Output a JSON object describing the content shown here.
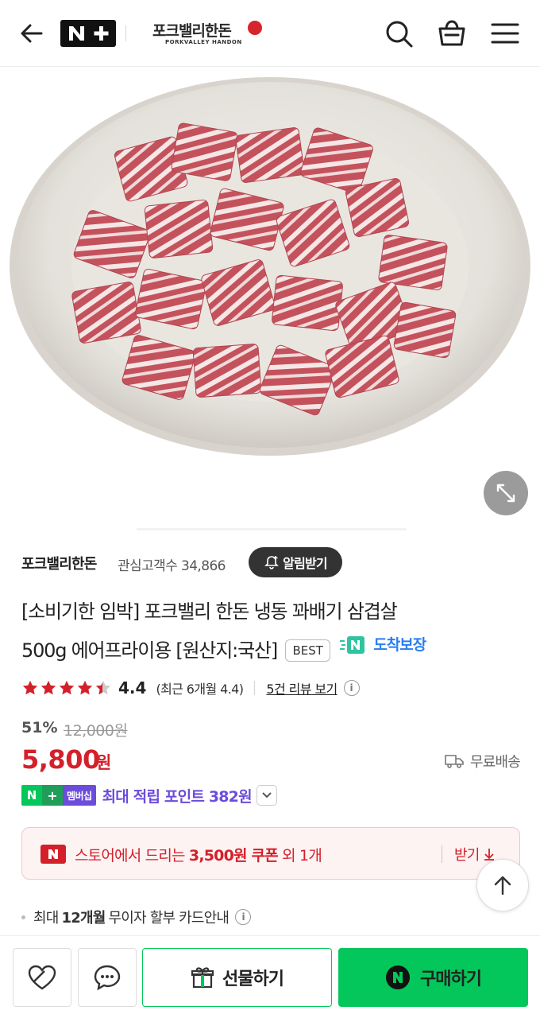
{
  "header": {
    "nplus_label": "N+",
    "brand_kor": "포크밸리한돈",
    "brand_eng": "PORKVALLEY HANDON",
    "icons": [
      "back-arrow-icon",
      "search-icon",
      "cart-icon",
      "menu-icon"
    ]
  },
  "store": {
    "name": "포크밸리한돈",
    "followers_label": "관심고객수 34,866",
    "alarm_label": "알림받기"
  },
  "product": {
    "title_line1": "[소비기한 임박] 포크밸리 한돈 냉동 꽈배기 삼겹살",
    "title_line2": "500g 에어프라이용 [원산지:국산]",
    "best_badge": "BEST",
    "arrival_label": "도착보장"
  },
  "rating": {
    "score": "4.4",
    "stars": 4.4,
    "recent": "(최근 6개월 4.4)",
    "review_link": "5건 리뷰 보기",
    "info": "i"
  },
  "price": {
    "discount": "51%",
    "original": "12,000원",
    "sale": "5,800",
    "unit": "원",
    "shipping": "무료배송"
  },
  "membership": {
    "n": "N",
    "plus": "+",
    "label": "멤버십",
    "text": "최대 적립 포인트 382원"
  },
  "coupon": {
    "prefix": "스토어에서 드리는 ",
    "amount": "3,500원 쿠폰",
    "suffix": " 외 1개",
    "action": "받기"
  },
  "installment": {
    "prefix": "최대",
    "months": "12개월",
    "suffix": "무이자 할부 카드안내"
  },
  "bottom": {
    "gift_label": "선물하기",
    "buy_label": "구매하기"
  },
  "colors": {
    "accent_red": "#d4202a",
    "naver_green": "#03c75a",
    "membership_purple": "#6c4cdb",
    "arrival_blue": "#2a7df0"
  }
}
